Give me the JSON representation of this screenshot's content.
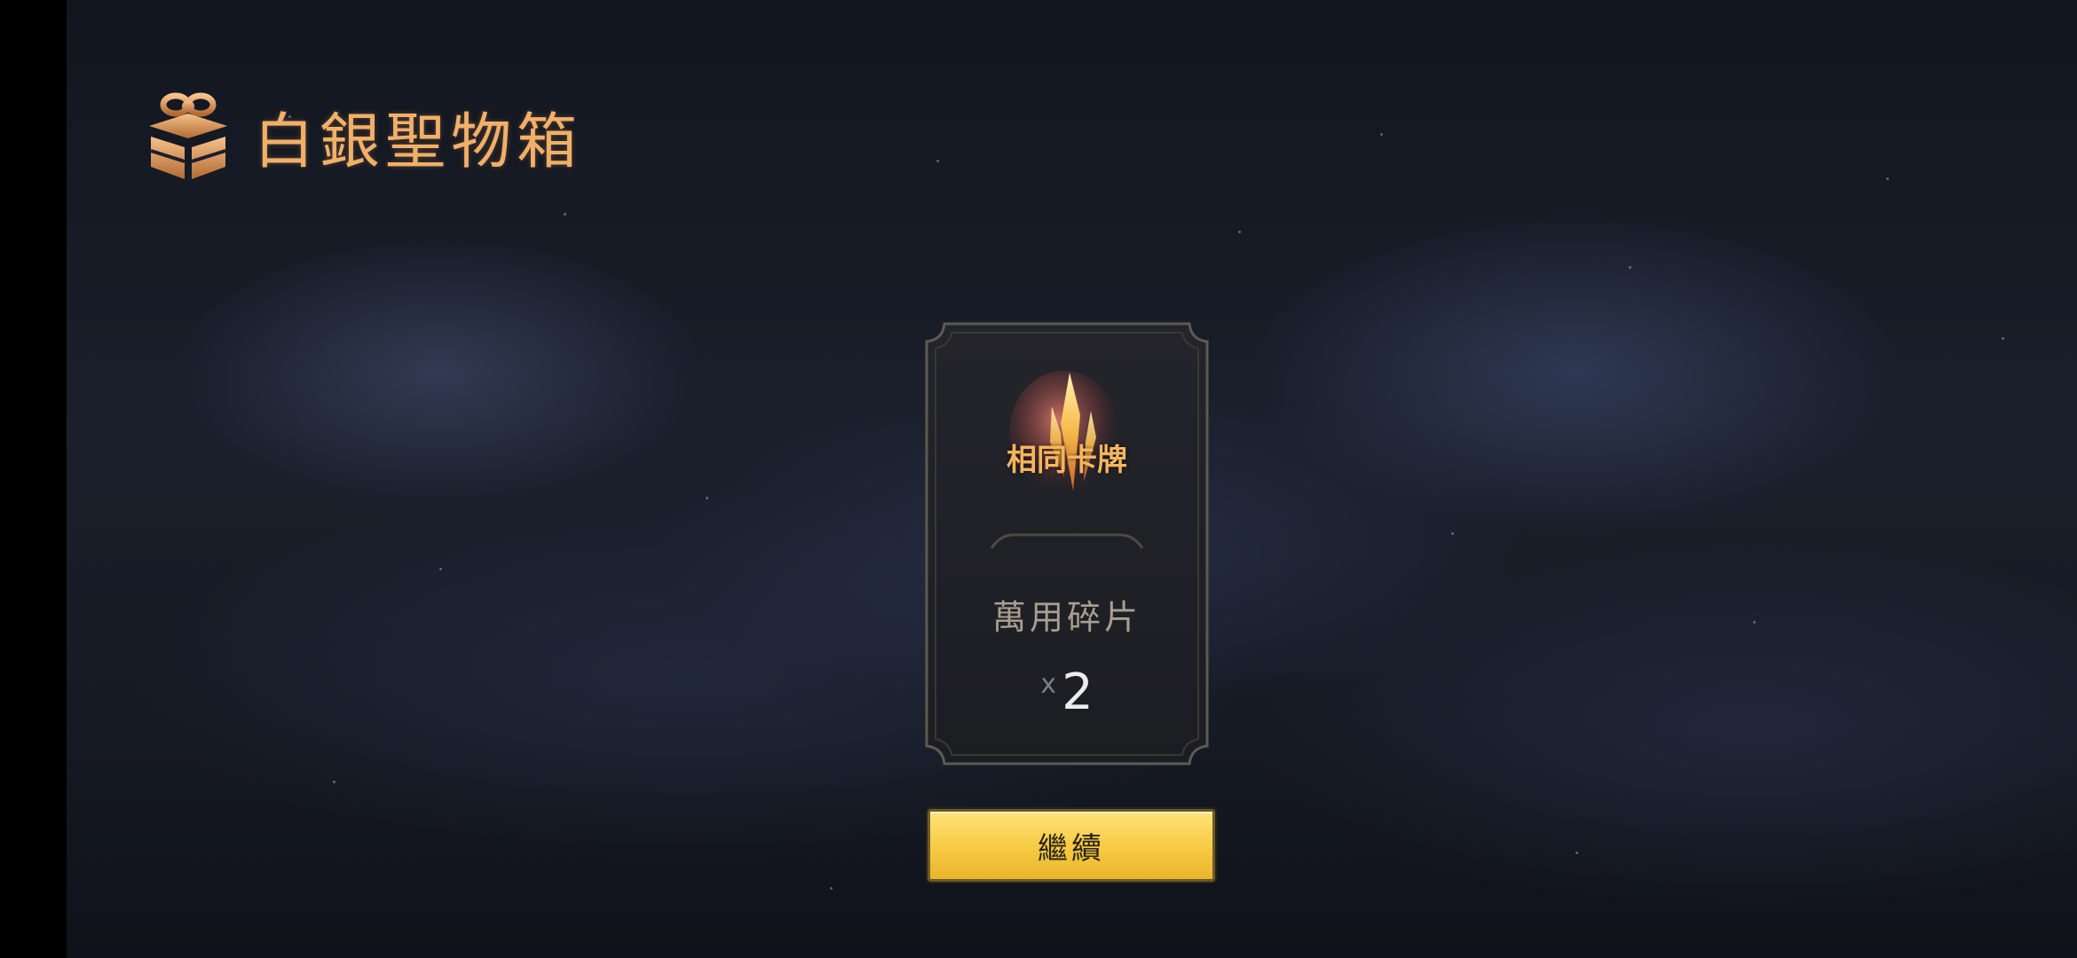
{
  "header": {
    "title": "白銀聖物箱",
    "icon": "chest-icon"
  },
  "reward_card": {
    "badge": "相同卡牌",
    "item_name": "萬用碎片",
    "quantity_prefix": "x",
    "quantity": "2",
    "art_icon": "crystal-shard-icon"
  },
  "actions": {
    "continue_label": "繼續"
  },
  "colors": {
    "title": "#f0b06a",
    "badge": "#f6b55e",
    "button_top": "#ffe37a",
    "button_bottom": "#eab52e",
    "background": "#161a24"
  }
}
